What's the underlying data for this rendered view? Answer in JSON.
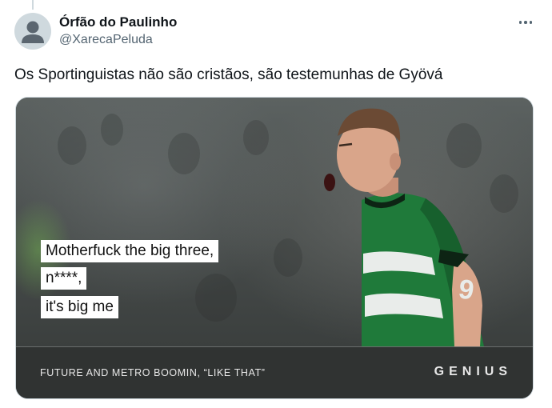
{
  "tweet": {
    "display_name": "Órfão do Paulinho",
    "handle": "@XarecaPeluda",
    "text": "Os Sportinguistas não são cristãos, são testemunhas de Gyövá",
    "more_icon": "more-dots-icon"
  },
  "media": {
    "lyrics": [
      "Motherfuck the big three,",
      "n****,",
      " it's big me"
    ],
    "caption": "FUTURE AND METRO BOOMIN, “LIKE THAT”",
    "brand": "GENIUS",
    "jersey_colors": {
      "green": "#1f7a3a",
      "white": "#e9ecea"
    }
  }
}
